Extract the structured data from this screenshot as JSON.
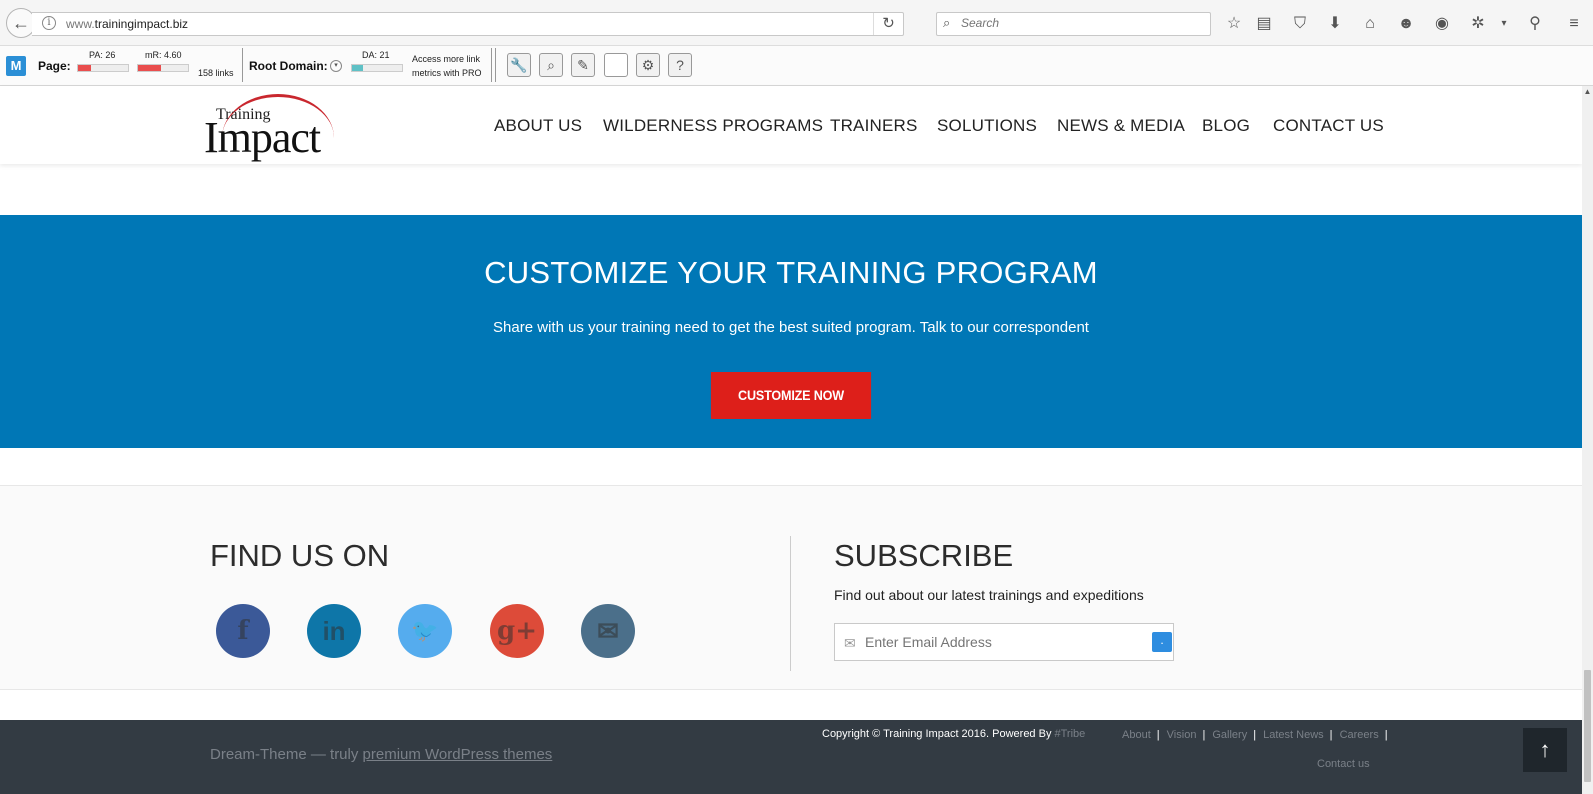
{
  "browser": {
    "url_prefix": "www.",
    "url_host": "trainingimpact.biz",
    "search_placeholder": "Search"
  },
  "moz": {
    "page_label": "Page:",
    "pa": "PA: 26",
    "pa_fill": 0.26,
    "mr": "mR: 4.60",
    "mr_fill": 0.46,
    "links": "158 links",
    "root_label": "Root Domain:",
    "da": "DA: 21",
    "da_fill": 0.21,
    "access_line1": "Access more link",
    "access_line2": "metrics with PRO",
    "tools": [
      "wrench-icon",
      "magnifier-icon",
      "pencil-icon",
      "blank-icon",
      "gear-icon",
      "help-icon"
    ]
  },
  "header": {
    "logo_training": "Training",
    "logo_impact": "Impact",
    "nav": [
      "ABOUT US",
      "WILDERNESS PROGRAMS",
      "TRAINERS",
      "SOLUTIONS",
      "NEWS & MEDIA",
      "BLOG",
      "CONTACT US"
    ]
  },
  "cta": {
    "title": "CUSTOMIZE YOUR TRAINING PROGRAM",
    "subtitle": "Share with us your training need to get the best suited program. Talk to our correspondent",
    "button": "CUSTOMIZE NOW",
    "bg_color": "#0077b6",
    "button_color": "#dd1f1a"
  },
  "find_us": {
    "title": "FIND US ON",
    "socials": [
      {
        "name": "facebook-icon",
        "glyph": "f",
        "color": "#3b5998"
      },
      {
        "name": "linkedin-icon",
        "glyph": "in",
        "color": "#0e76a8"
      },
      {
        "name": "twitter-icon",
        "glyph": "🐦",
        "color": "#55acee"
      },
      {
        "name": "google-plus-icon",
        "glyph": "g+",
        "color": "#dd4b39"
      },
      {
        "name": "email-icon",
        "glyph": "✉",
        "color": "#4b6f8a"
      }
    ]
  },
  "subscribe": {
    "title": "SUBSCRIBE",
    "text": "Find out about our latest trainings and expeditions",
    "placeholder": "Enter Email Address",
    "button": "."
  },
  "footer": {
    "dt_prefix": "Dream-Theme — truly ",
    "dt_link": "premium WordPress themes",
    "copyright": "Copyright © Training Impact 2016. Powered By ",
    "tribe": "#Tribe",
    "links": [
      "About",
      "Vision",
      "Gallery",
      "Latest News",
      "Careers"
    ],
    "contact": "Contact us"
  }
}
